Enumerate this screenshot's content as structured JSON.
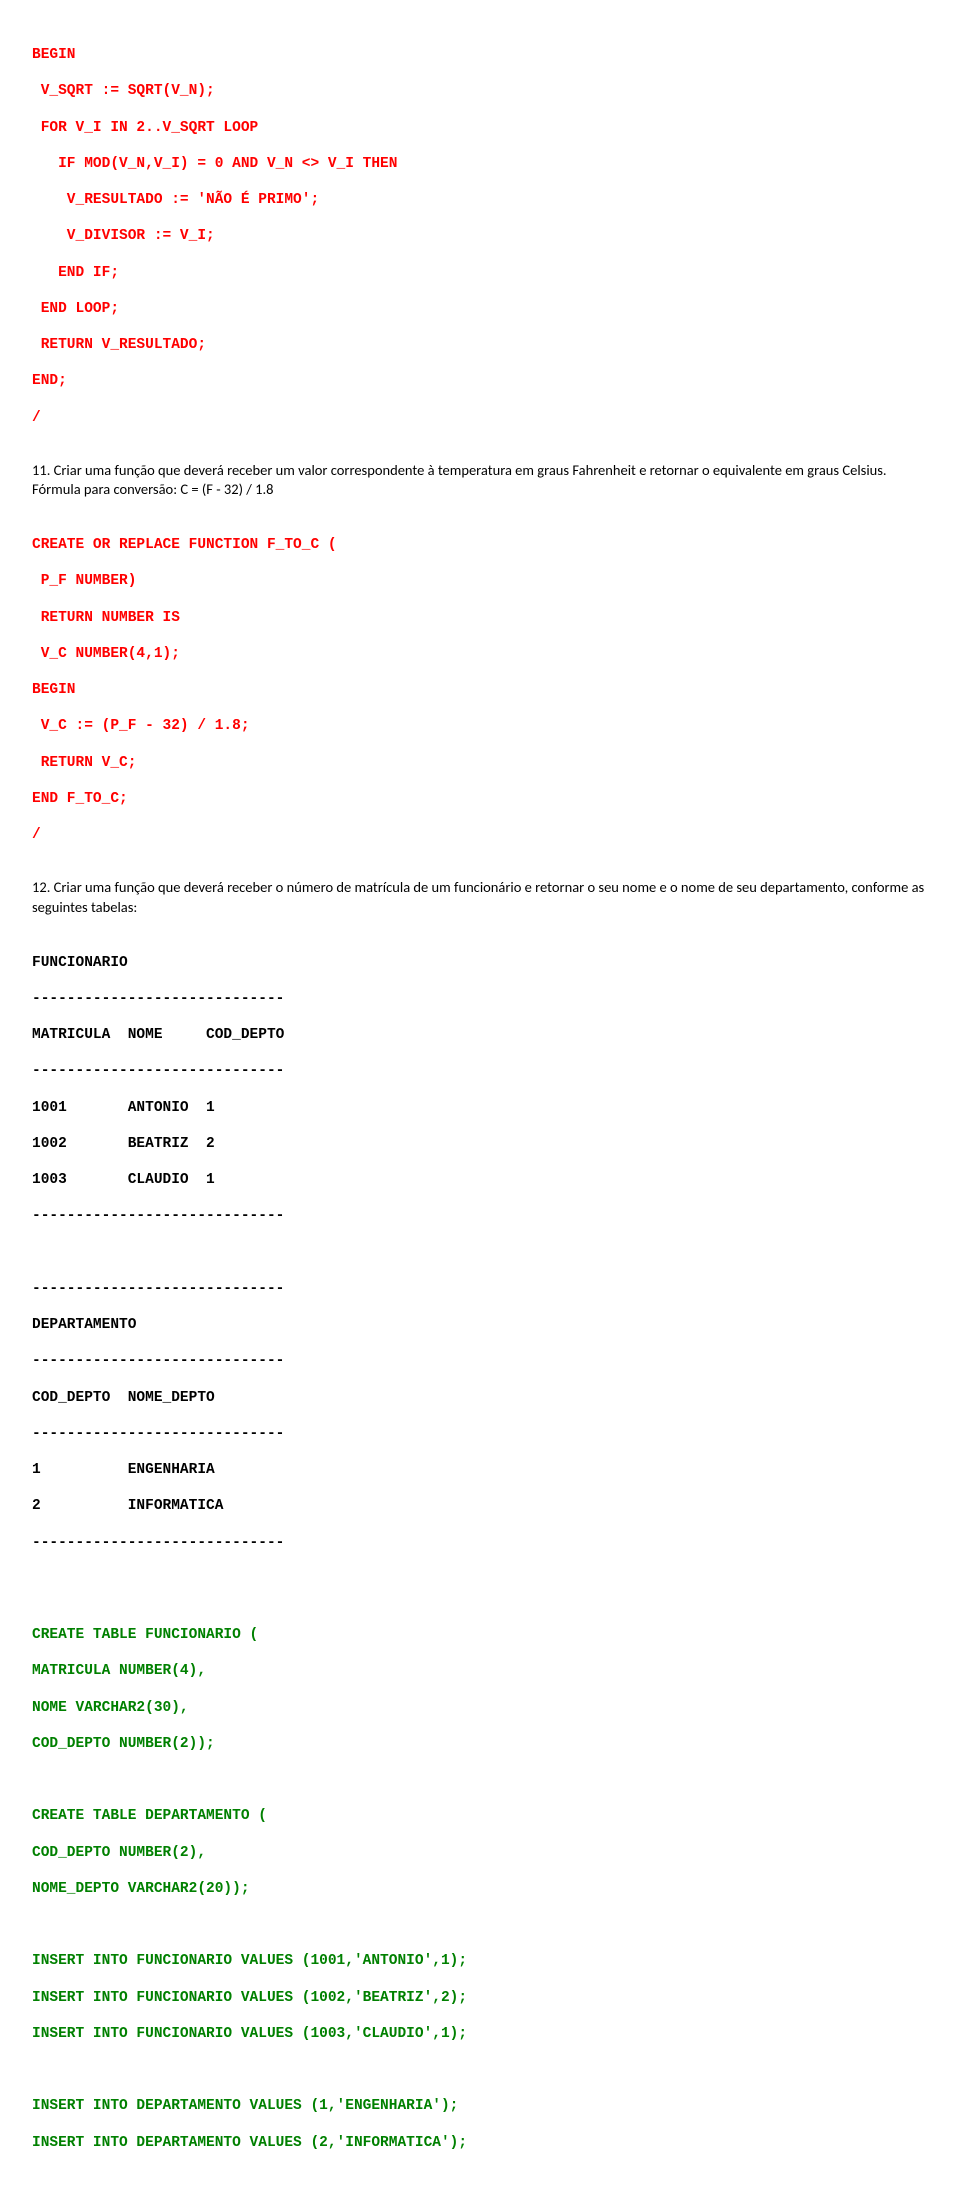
{
  "block1": {
    "l1": "BEGIN",
    "l2": " V_SQRT := SQRT(V_N);",
    "l3": " FOR V_I IN 2..V_SQRT LOOP",
    "l4": "   IF MOD(V_N,V_I) = 0 AND V_N <> V_I THEN",
    "l5": "    V_RESULTADO := 'NÃO É PRIMO';",
    "l6": "    V_DIVISOR := V_I;",
    "l7": "   END IF;",
    "l8": " END LOOP;",
    "l9": " RETURN V_RESULTADO;",
    "l10": "END;",
    "l11": "/"
  },
  "q11": "11. Criar uma função que deverá receber um valor correspondente à temperatura em graus Fahrenheit e retornar o equivalente em graus Celsius. Fórmula para conversão: C = (F - 32) / 1.8",
  "block2": {
    "l1": "CREATE OR REPLACE FUNCTION F_TO_C (",
    "l2": " P_F NUMBER)",
    "l3": " RETURN NUMBER IS",
    "l4": " V_C NUMBER(4,1);",
    "l5": "BEGIN",
    "l6": " V_C := (P_F - 32) / 1.8;",
    "l7": " RETURN V_C;",
    "l8": "END F_TO_C;",
    "l9": "/"
  },
  "q12": "12. Criar uma função que deverá receber o número de matrícula de um funcionário e retornar o seu nome e o nome de seu departamento, conforme as seguintes tabelas:",
  "tables": {
    "l1": "FUNCIONARIO",
    "l2": "-----------------------------",
    "l3": "MATRICULA  NOME     COD_DEPTO",
    "l4": "-----------------------------",
    "l5": "1001       ANTONIO  1",
    "l6": "1002       BEATRIZ  2",
    "l7": "1003       CLAUDIO  1",
    "l8": "-----------------------------",
    "l9": "",
    "l10": "-----------------------------",
    "l11": "DEPARTAMENTO",
    "l12": "-----------------------------",
    "l13": "COD_DEPTO  NOME_DEPTO",
    "l14": "-----------------------------",
    "l15": "1          ENGENHARIA",
    "l16": "2          INFORMATICA",
    "l17": "-----------------------------"
  },
  "block3": {
    "l1": "CREATE TABLE FUNCIONARIO (",
    "l2": "MATRICULA NUMBER(4),",
    "l3": "NOME VARCHAR2(30),",
    "l4": "COD_DEPTO NUMBER(2));",
    "l5": "",
    "l6": "CREATE TABLE DEPARTAMENTO (",
    "l7": "COD_DEPTO NUMBER(2),",
    "l8": "NOME_DEPTO VARCHAR2(20));",
    "l9": "",
    "l10": "INSERT INTO FUNCIONARIO VALUES (1001,'ANTONIO',1);",
    "l11": "INSERT INTO FUNCIONARIO VALUES (1002,'BEATRIZ',2);",
    "l12": "INSERT INTO FUNCIONARIO VALUES (1003,'CLAUDIO',1);",
    "l13": "",
    "l14": "INSERT INTO DEPARTAMENTO VALUES (1,'ENGENHARIA');",
    "l15": "INSERT INTO DEPARTAMENTO VALUES (2,'INFORMATICA');"
  }
}
